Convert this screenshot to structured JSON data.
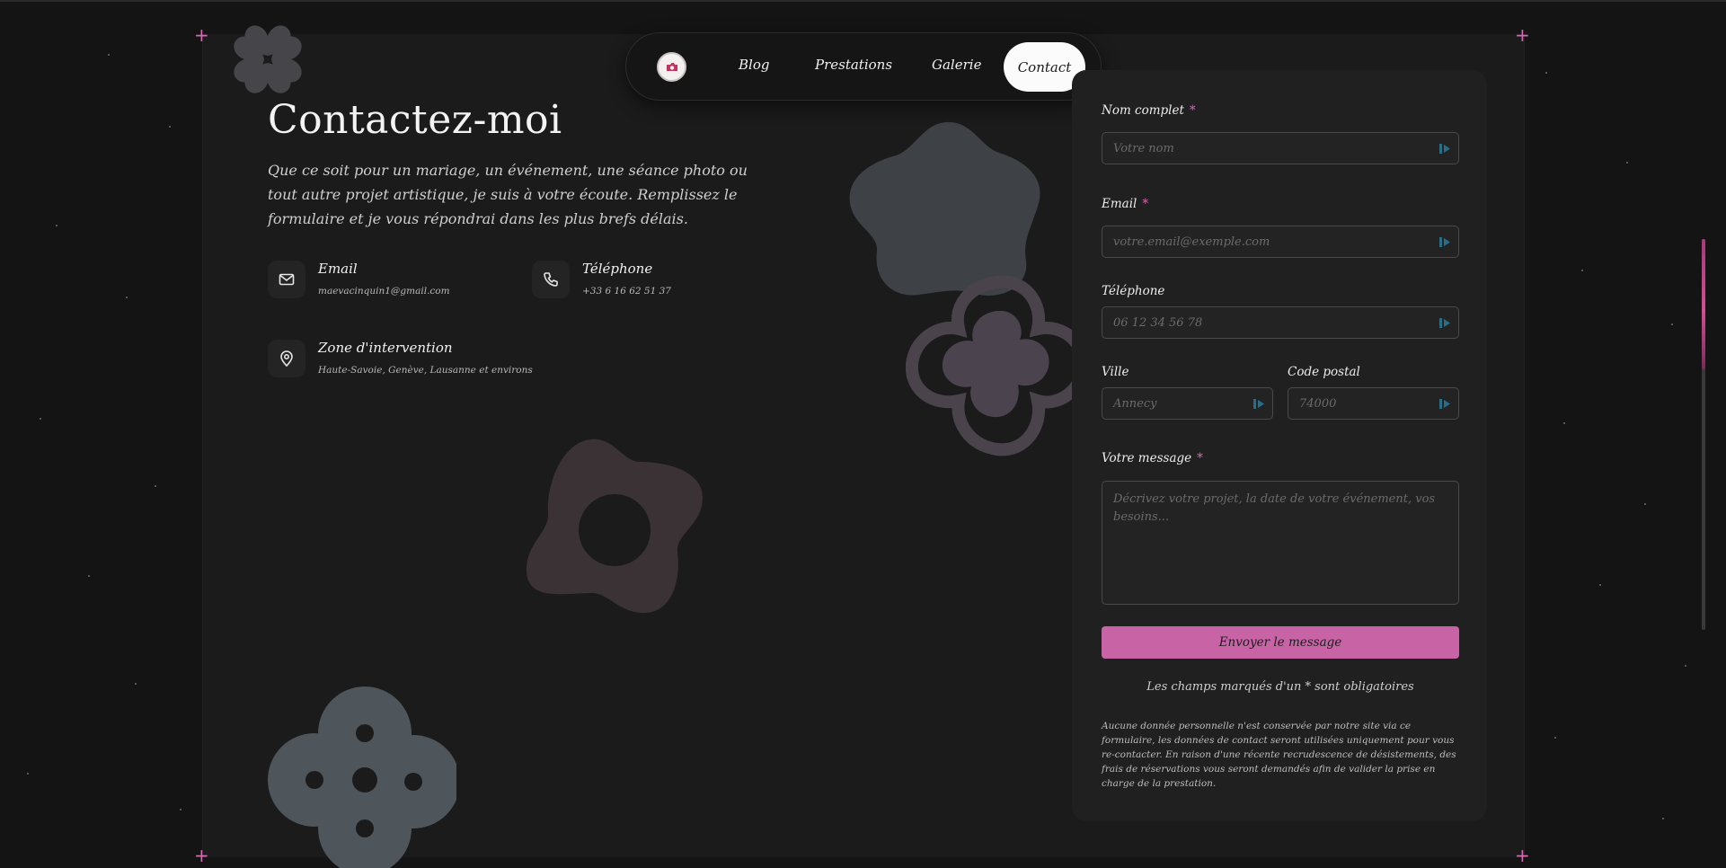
{
  "nav": {
    "logo_icon": "camera-logo-icon",
    "items": [
      {
        "label": "Blog"
      },
      {
        "label": "Prestations"
      },
      {
        "label": "Galerie"
      },
      {
        "label": "Contact",
        "active": true
      }
    ]
  },
  "header": {
    "title": "Contactez-moi",
    "intro": "Que ce soit pour un mariage, un événement, une séance photo ou tout autre projet artistique, je suis à votre écoute. Remplissez le formulaire et je vous répondrai dans les plus brefs délais."
  },
  "contact_info": [
    {
      "title": "Email",
      "value": "maevacinquin1@gmail.com",
      "icon": "mail-icon"
    },
    {
      "title": "Téléphone",
      "value": "+33 6 16 62 51 37",
      "icon": "phone-icon"
    },
    {
      "title": "Zone d'intervention",
      "value": "Haute-Savoie, Genève, Lausanne et environs",
      "icon": "map-pin-icon"
    }
  ],
  "form": {
    "name": {
      "label": "Nom complet",
      "required": "*",
      "placeholder": "Votre nom"
    },
    "email": {
      "label": "Email",
      "required": "*",
      "placeholder": "votre.email@exemple.com"
    },
    "phone": {
      "label": "Téléphone",
      "placeholder": "06 12 34 56 78"
    },
    "city": {
      "label": "Ville",
      "placeholder": "Annecy"
    },
    "postal": {
      "label": "Code postal",
      "placeholder": "74000"
    },
    "message": {
      "label": "Votre message",
      "required": "*",
      "placeholder": "Décrivez votre projet, la date de votre événement, vos besoins..."
    },
    "submit_label": "Envoyer le message",
    "required_note": "Les champs marqués d'un * sont obligatoires",
    "privacy_note": "Aucune donnée personnelle n'est conservée par notre site via ce formulaire, les données de contact seront utilisées uniquement pour vous re-contacter. En raison d'une récente recrudescence de désistements, des frais de réservations vous seront demandés afin de valider la prise en charge de la prestation."
  },
  "colors": {
    "accent": "#c864a6",
    "corner": "#d56ab2",
    "background": "#141414",
    "panel": "#1b1b1b",
    "card": "#202020"
  }
}
